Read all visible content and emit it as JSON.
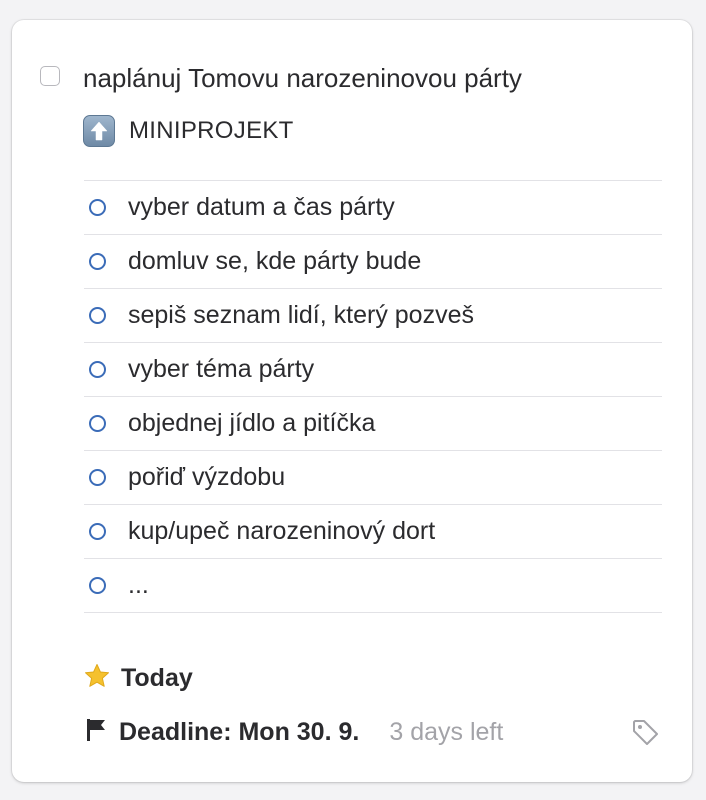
{
  "task": {
    "title": "naplánuj Tomovu narozeninovou párty",
    "completed": false
  },
  "project": {
    "icon": "arrow-up-icon",
    "label": "MINIPROJEKT"
  },
  "checklist": [
    {
      "label": "vyber datum a čas párty"
    },
    {
      "label": "domluv se, kde párty bude"
    },
    {
      "label": "sepiš seznam lidí, který pozveš"
    },
    {
      "label": "vyber téma párty"
    },
    {
      "label": "objednej jídlo a pitíčka"
    },
    {
      "label": "pořiď výzdobu"
    },
    {
      "label": "kup/upeč narozeninový dort"
    },
    {
      "label": "..."
    }
  ],
  "when": {
    "icon": "star-icon",
    "label": "Today"
  },
  "deadline": {
    "icon": "flag-icon",
    "label": "Deadline: Mon 30. 9.",
    "days_left": "3 days left"
  },
  "tag_icon": "tag-icon",
  "colors": {
    "checklist_circle": "#3b6cb8",
    "star": "#f5c12e",
    "muted_text": "#a3a3a8"
  }
}
